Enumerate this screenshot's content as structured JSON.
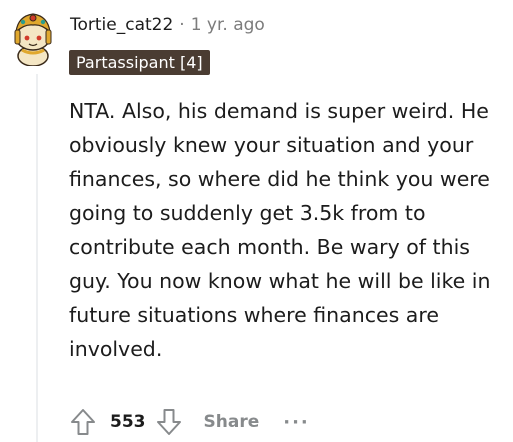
{
  "comment": {
    "username": "Tortie_cat22",
    "separator": "·",
    "timestamp": "1 yr. ago",
    "flair": "Partassipant [4]",
    "body": "NTA. Also, his demand is super weird. He obviously knew your situation and your finances, so where did he think you were going to suddenly get 3.5k from to contribute each month. Be wary of this guy. You now know what he will be like in future situations where finances are involved."
  },
  "actions": {
    "score": "553",
    "share_label": "Share",
    "more_label": "···"
  },
  "icons": {
    "avatar": "snoo-avatar-crowned",
    "upvote": "upvote-arrow-icon",
    "downvote": "downvote-arrow-icon",
    "more": "more-dots-icon"
  },
  "colors": {
    "flair_background": "#4a3c32",
    "muted_text": "#7c7c7c",
    "action_text": "#878a8c"
  }
}
